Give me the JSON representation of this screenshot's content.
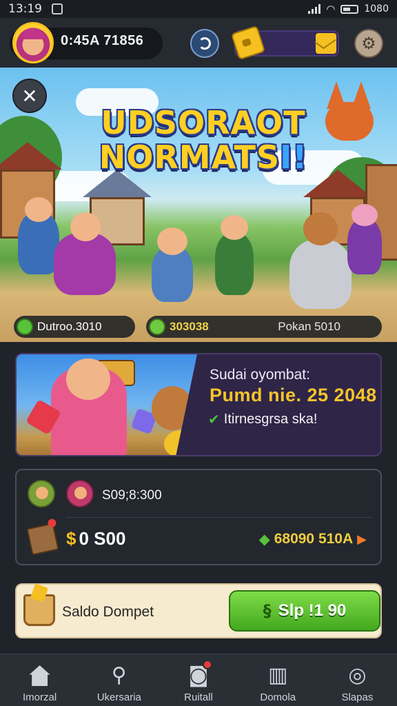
{
  "status_bar": {
    "time": "13:19",
    "right_text": "1080"
  },
  "top_bar": {
    "player_id": "0:45A 71856"
  },
  "hero": {
    "title_line1": "UDSORAOT",
    "title_line2_main": "NORMATS",
    "title_line2_accent": "I!",
    "stat_left": "Dutroo.3010",
    "stat_middle": "303038",
    "stat_right": "Pokan 5010"
  },
  "promo": {
    "line1": "Sudai oyombat:",
    "line2": "Pumd nie. 25 2048",
    "line3": "Itirnesgrsa ska!"
  },
  "rewards": {
    "value1": "S09;8:300",
    "value2": "0 S00",
    "value2_symbol": "$",
    "right_value": "68090 510A"
  },
  "wallet": {
    "label": "Saldo Dompet",
    "cta_label": "Slp !1 90"
  },
  "bottom_nav": [
    {
      "label": "Imorzal",
      "icon": "home-icon"
    },
    {
      "label": "Ukersaria",
      "icon": "search-icon"
    },
    {
      "label": "Ruitall",
      "icon": "camera-icon"
    },
    {
      "label": "Domola",
      "icon": "cards-icon"
    },
    {
      "label": "Slapas",
      "icon": "support-icon"
    }
  ],
  "colors": {
    "accent": "#f6c42b",
    "cta": "#43a81f",
    "background": "#1f232a"
  }
}
